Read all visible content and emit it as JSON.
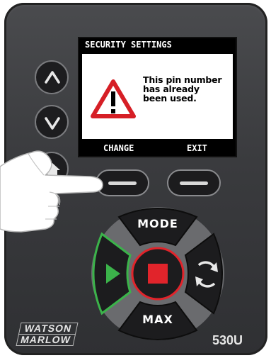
{
  "screen": {
    "title": "SECURITY SETTINGS",
    "message_lines": [
      "This pin number",
      "has already",
      "been used."
    ],
    "softkey_left": "CHANGE",
    "softkey_right": "EXIT"
  },
  "pad": {
    "top_label": "MODE",
    "bottom_label": "MAX"
  },
  "brand": {
    "line1": "WATSON",
    "line2": "MARLOW",
    "model": "530U"
  },
  "colors": {
    "start": "#3bb34a",
    "stop": "#e1242b",
    "stop_ring": "#e1242b",
    "body": "#3f4043"
  },
  "icons": [
    "up-arrow-icon",
    "down-arrow-icon",
    "home-icon",
    "warning-icon",
    "play-icon",
    "stop-icon",
    "reverse-direction-icon"
  ]
}
